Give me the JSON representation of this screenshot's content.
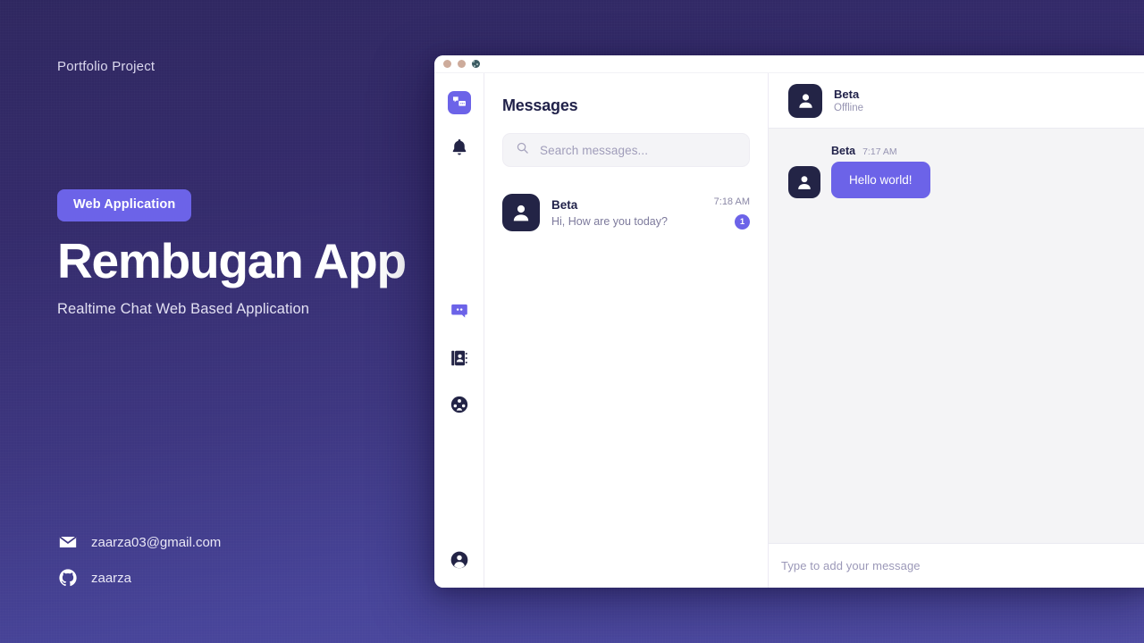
{
  "hero": {
    "eyebrow": "Portfolio Project",
    "badge": "Web Application",
    "title": "Rembugan App",
    "subtitle": "Realtime Chat Web Based Application",
    "accent_color": "#6c63e8",
    "contacts": [
      {
        "icon": "envelope-icon",
        "text": "zaarza03@gmail.com"
      },
      {
        "icon": "github-icon",
        "text": "zaarza"
      }
    ]
  },
  "window": {
    "traffic_lights": [
      "close-dot",
      "minimize-dot",
      "maximize-dot"
    ],
    "rail": {
      "items": [
        {
          "icon": "app-logo-icon",
          "name": "app-logo",
          "active": true
        },
        {
          "icon": "bell-icon",
          "name": "notifications",
          "active": false
        },
        {
          "icon": "chat-bubble-icon",
          "name": "messages",
          "active": true
        },
        {
          "icon": "contacts-book-icon",
          "name": "contacts",
          "active": false
        },
        {
          "icon": "group-users-icon",
          "name": "groups",
          "active": false
        }
      ],
      "bottom": {
        "icon": "user-circle-icon",
        "name": "profile"
      }
    },
    "list": {
      "title": "Messages",
      "search_placeholder": "Search messages...",
      "search_value": "",
      "conversations": [
        {
          "name": "Beta",
          "preview": "Hi, How are you today?",
          "time": "7:18 AM",
          "unread": "1",
          "avatar": "user-avatar-icon"
        }
      ]
    },
    "chat": {
      "header": {
        "name": "Beta",
        "status": "Offline",
        "avatar": "user-avatar-icon"
      },
      "messages": [
        {
          "sender": "Beta",
          "time": "7:17 AM",
          "text": "Hello world!",
          "avatar": "user-avatar-icon",
          "side": "left"
        }
      ],
      "input_placeholder": "Type to add your message",
      "input_value": ""
    }
  }
}
